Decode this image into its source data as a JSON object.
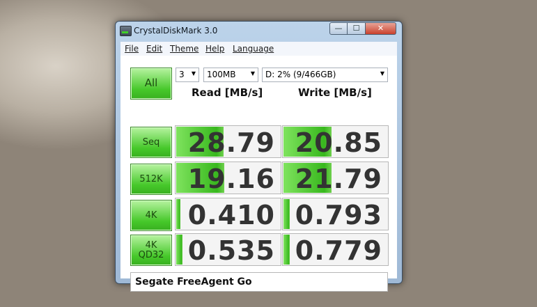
{
  "window": {
    "title": "CrystalDiskMark 3.0",
    "close_label": "✕",
    "max_label": "☐",
    "min_label": "—"
  },
  "menu": [
    "File",
    "Edit",
    "Theme",
    "Help",
    "Language"
  ],
  "controls": {
    "all_label": "All",
    "count": "3",
    "size": "100MB",
    "drive": "D: 2% (9/466GB)"
  },
  "headers": {
    "read": "Read [MB/s]",
    "write": "Write [MB/s]"
  },
  "rows": [
    {
      "label": "Seq",
      "label2": "",
      "read": "28.79",
      "write": "20.85",
      "read_fill": 0.45,
      "write_fill": 0.46
    },
    {
      "label": "512K",
      "label2": "",
      "read": "19.16",
      "write": "21.79",
      "read_fill": 0.46,
      "write_fill": 0.46
    },
    {
      "label": "4K",
      "label2": "",
      "read": "0.410",
      "write": "0.793",
      "read_fill": 0.04,
      "write_fill": 0.06
    },
    {
      "label": "4K",
      "label2": "QD32",
      "read": "0.535",
      "write": "0.779",
      "read_fill": 0.06,
      "write_fill": 0.06
    }
  ],
  "comment": "Segate FreeAgent Go",
  "colors": {
    "accent_green": "#46c82a"
  }
}
